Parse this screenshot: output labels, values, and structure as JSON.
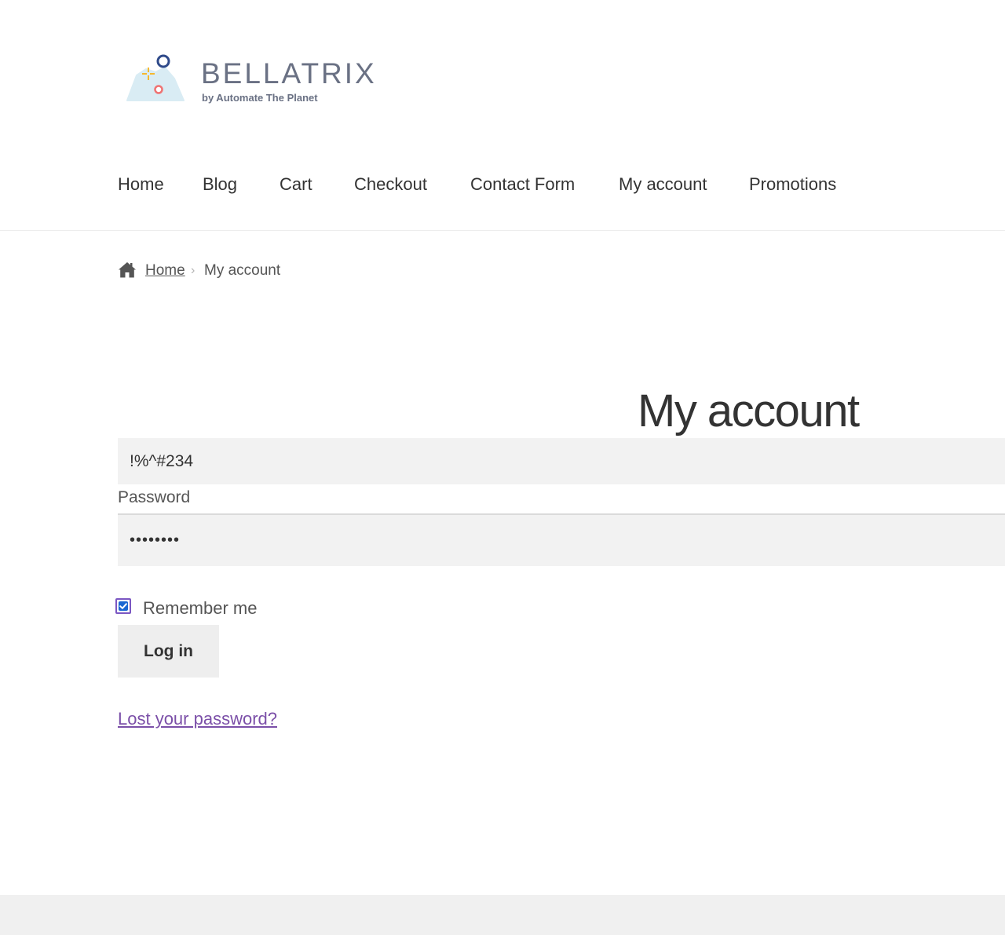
{
  "site": {
    "logo_text": "BELLATRIX",
    "logo_subtext": "by Automate The Planet"
  },
  "nav": {
    "items": [
      {
        "label": "Home"
      },
      {
        "label": "Blog"
      },
      {
        "label": "Cart"
      },
      {
        "label": "Checkout"
      },
      {
        "label": "Contact Form"
      },
      {
        "label": "My account"
      },
      {
        "label": "Promotions"
      }
    ]
  },
  "breadcrumb": {
    "home_label": "Home",
    "separator": "›",
    "current": "My account"
  },
  "page": {
    "title": "My account"
  },
  "login_form": {
    "username_value": "!%^#234",
    "password_label": "Password",
    "password_value": "••••••••",
    "remember_label": "Remember me",
    "remember_checked": true,
    "submit_label": "Log in",
    "lost_password_label": "Lost your password?"
  },
  "colors": {
    "link_purple": "#7b4fa8",
    "checkbox_blue": "#1a67d2",
    "field_bg": "#f2f2f2",
    "footer_bg": "#f0f0f0"
  }
}
